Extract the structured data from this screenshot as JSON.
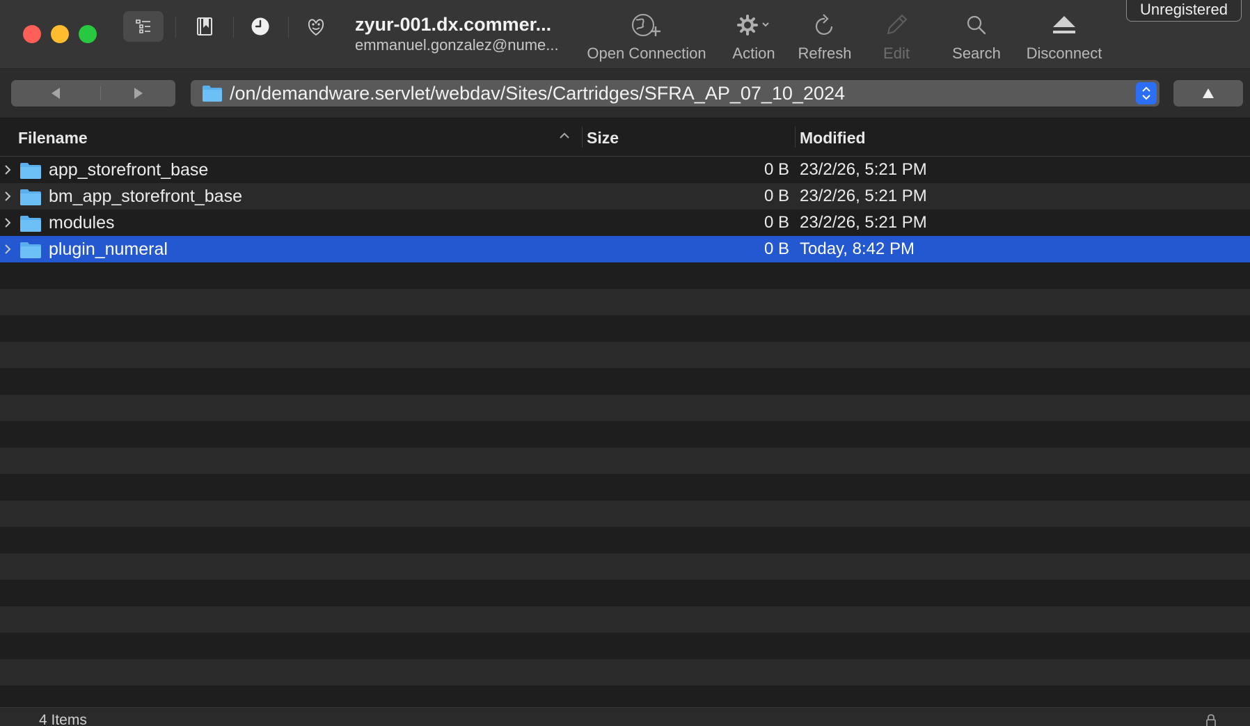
{
  "window": {
    "host_title": "zyur-001.dx.commer...",
    "host_subtitle": "emmanuel.gonzalez@nume...",
    "badge": "Unregistered"
  },
  "toolbar": {
    "view_buttons": [
      {
        "icon": "outline-view-icon",
        "active": true
      },
      {
        "icon": "bookmarks-icon",
        "active": false
      },
      {
        "icon": "history-icon",
        "active": false
      },
      {
        "icon": "bonjour-icon",
        "active": false
      }
    ],
    "actions": [
      {
        "label": "Open Connection",
        "icon": "globe-plus-icon",
        "enabled": true
      },
      {
        "label": "Action",
        "icon": "gear-icon",
        "enabled": true
      },
      {
        "label": "Refresh",
        "icon": "refresh-icon",
        "enabled": true
      },
      {
        "label": "Edit",
        "icon": "pencil-icon",
        "enabled": false
      },
      {
        "label": "Search",
        "icon": "search-icon",
        "enabled": true
      },
      {
        "label": "Disconnect",
        "icon": "eject-icon",
        "enabled": true
      }
    ]
  },
  "pathbar": {
    "back_icon": "back-arrow-icon",
    "forward_icon": "forward-arrow-icon",
    "path": "/on/demandware.servlet/webdav/Sites/Cartridges/SFRA_AP_07_10_2024",
    "up_icon": "up-arrow-icon",
    "accent": "#2d6ef6"
  },
  "table": {
    "columns": [
      "Filename",
      "Size",
      "Modified"
    ],
    "sort_column": "Filename",
    "sort_direction": "ascending",
    "rows": [
      {
        "name": "app_storefront_base",
        "size": "0 B",
        "modified": "23/2/26, 5:21 PM",
        "selected": false
      },
      {
        "name": "bm_app_storefront_base",
        "size": "0 B",
        "modified": "23/2/26, 5:21 PM",
        "selected": false
      },
      {
        "name": "modules",
        "size": "0 B",
        "modified": "23/2/26, 5:21 PM",
        "selected": false
      },
      {
        "name": "plugin_numeral",
        "size": "0 B",
        "modified": "Today, 8:42 PM",
        "selected": true
      }
    ],
    "selection_color": "#2358d0",
    "folder_color": "#5ab0ec"
  },
  "status": {
    "item_count": "4 Items",
    "lock_icon": "lock-icon"
  }
}
